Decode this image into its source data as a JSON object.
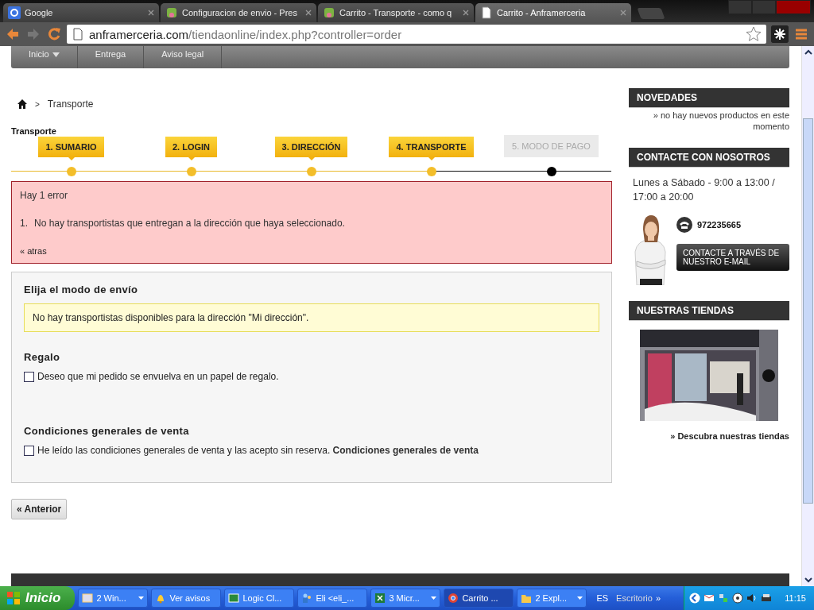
{
  "browser": {
    "tabs": [
      {
        "title": "Google",
        "kind": "google",
        "selected": false
      },
      {
        "title": "Configuracion de envio - Pres",
        "kind": "leaf",
        "selected": false
      },
      {
        "title": "Carrito - Transporte - como q",
        "kind": "leaf",
        "selected": false
      },
      {
        "title": "Carrito - Anframerceria",
        "kind": "page",
        "selected": true
      }
    ],
    "address": {
      "domain": "anframerceria.com",
      "path": "/tiendaonline/index.php?controller=order"
    }
  },
  "nav": {
    "items": [
      {
        "label": "Inicio",
        "dropdown": true
      },
      {
        "label": "Entrega",
        "dropdown": false
      },
      {
        "label": "Aviso legal",
        "dropdown": false
      }
    ]
  },
  "breadcrumb": {
    "separator": ">",
    "current": "Transporte"
  },
  "page_title": "Transporte",
  "steps": [
    {
      "label": "1. SUMARIO",
      "done": true
    },
    {
      "label": "2. LOGIN",
      "done": true
    },
    {
      "label": "3. DIRECCIÓN",
      "done": true
    },
    {
      "label": "4. TRANSPORTE",
      "done": true
    },
    {
      "label": "5. MODO DE PAGO",
      "done": false
    }
  ],
  "error": {
    "title": "Hay 1 error",
    "items": [
      {
        "number": "1.",
        "text": "No hay transportistas que entregan a la dirección que haya seleccionado."
      }
    ],
    "back_link": "« atras"
  },
  "shipping": {
    "heading": "Elija el modo de envío",
    "notice": "No hay transportistas disponibles para la dirección \"Mi dirección\".",
    "sections": [
      {
        "heading": "Regalo",
        "checked": false,
        "label": "Deseo que mi pedido se envuelva en un papel de regalo."
      },
      {
        "heading": "Condiciones generales de venta",
        "checked": false,
        "label": "He leído las condiciones generales de venta y las acepto sin reserva.",
        "link": "Condiciones generales de venta"
      }
    ]
  },
  "back_button": "« Anterior",
  "sidebar": {
    "news": {
      "title": "NOVEDADES",
      "text": "» no hay nuevos productos en este momento"
    },
    "contact": {
      "title": "CONTACTE CON NOSOTROS",
      "hours": "Lunes a Sábado - 9:00 a 13:00 / 17:00 a 20:00",
      "phone": "972235665",
      "email_button": "CONTACTE A TRAVÉS DE NUESTRO E-MAIL"
    },
    "stores": {
      "title": "NUESTRAS TIENDAS",
      "link": "» Descubra nuestras tiendas"
    }
  },
  "taskbar": {
    "start": "Inicio",
    "items": [
      {
        "label": "2 Win...",
        "kind": "window",
        "grouped": true,
        "selected": false
      },
      {
        "label": "Ver avisos",
        "kind": "bell",
        "grouped": false,
        "selected": false
      },
      {
        "label": "Logic Cl...",
        "kind": "app",
        "grouped": false,
        "selected": false
      },
      {
        "label": "Eli <eli_...",
        "kind": "people",
        "grouped": false,
        "selected": false
      },
      {
        "label": "3 Micr...",
        "kind": "sheet",
        "grouped": true,
        "selected": false
      },
      {
        "label": "Carrito ...",
        "kind": "browser",
        "grouped": false,
        "selected": true
      },
      {
        "label": "2 Expl...",
        "kind": "folder",
        "grouped": true,
        "selected": false
      }
    ],
    "language": "ES",
    "desktop": "Escritorio",
    "more": "»",
    "clock": "11:15"
  }
}
